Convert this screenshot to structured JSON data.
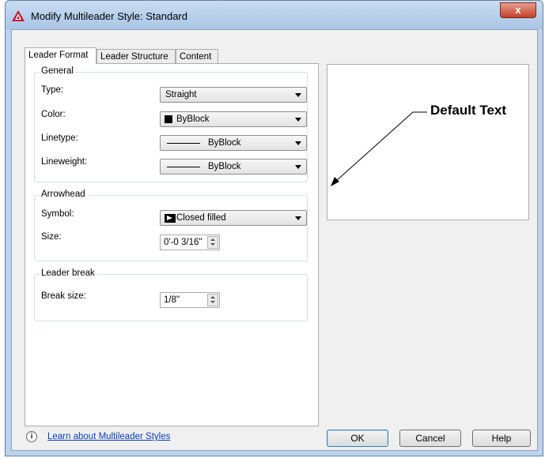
{
  "window": {
    "title": "Modify Multileader Style: Standard",
    "close_glyph": "x",
    "app_icon": "autocad-logo-icon"
  },
  "tabs": [
    {
      "label": "Leader Format",
      "active": true
    },
    {
      "label": "Leader Structure",
      "active": false
    },
    {
      "label": "Content",
      "active": false
    }
  ],
  "general": {
    "title": "General",
    "type_label": "Type:",
    "type_value": "Straight",
    "color_label": "Color:",
    "color_value": "ByBlock",
    "linetype_label": "Linetype:",
    "linetype_value": "ByBlock",
    "lineweight_label": "Lineweight:",
    "lineweight_value": "ByBlock"
  },
  "arrowhead": {
    "title": "Arrowhead",
    "symbol_label": "Symbol:",
    "symbol_value": "Closed filled",
    "size_label": "Size:",
    "size_value": "0'-0 3/16\""
  },
  "leader_break": {
    "title": "Leader break",
    "break_size_label": "Break size:",
    "break_size_value": "1/8\""
  },
  "preview": {
    "text": "Default Text"
  },
  "footer": {
    "info_glyph": "i",
    "link_text": "Learn about Multileader Styles",
    "ok_label": "OK",
    "cancel_label": "Cancel",
    "help_label": "Help"
  }
}
